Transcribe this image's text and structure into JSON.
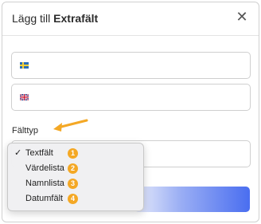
{
  "dialog": {
    "title_prefix": "Lägg till",
    "title_bold": "Extrafält",
    "close_label": "✕"
  },
  "fields": {
    "swedish": {
      "flag_icon": "flag-se-icon",
      "value": ""
    },
    "english": {
      "flag_icon": "flag-gb-icon",
      "value": ""
    }
  },
  "field_type": {
    "label": "Fälttyp",
    "selected": "Textfält",
    "options": [
      {
        "label": "Textfält",
        "checked": true,
        "step": "1"
      },
      {
        "label": "Värdelista",
        "checked": false,
        "step": "2"
      },
      {
        "label": "Namnlista",
        "checked": false,
        "step": "3"
      },
      {
        "label": "Datumfält",
        "checked": false,
        "step": "4"
      }
    ]
  },
  "colors": {
    "accent": "#4a6ef0",
    "badge": "#f4a825",
    "arrow": "#f4a825"
  }
}
